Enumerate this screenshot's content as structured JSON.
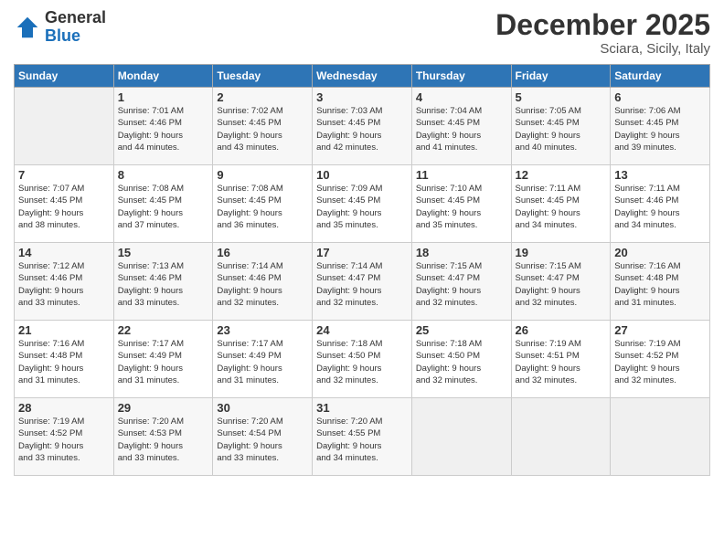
{
  "logo": {
    "general": "General",
    "blue": "Blue"
  },
  "title": "December 2025",
  "subtitle": "Sciara, Sicily, Italy",
  "headers": [
    "Sunday",
    "Monday",
    "Tuesday",
    "Wednesday",
    "Thursday",
    "Friday",
    "Saturday"
  ],
  "weeks": [
    [
      {
        "day": "",
        "detail": ""
      },
      {
        "day": "1",
        "detail": "Sunrise: 7:01 AM\nSunset: 4:46 PM\nDaylight: 9 hours\nand 44 minutes."
      },
      {
        "day": "2",
        "detail": "Sunrise: 7:02 AM\nSunset: 4:45 PM\nDaylight: 9 hours\nand 43 minutes."
      },
      {
        "day": "3",
        "detail": "Sunrise: 7:03 AM\nSunset: 4:45 PM\nDaylight: 9 hours\nand 42 minutes."
      },
      {
        "day": "4",
        "detail": "Sunrise: 7:04 AM\nSunset: 4:45 PM\nDaylight: 9 hours\nand 41 minutes."
      },
      {
        "day": "5",
        "detail": "Sunrise: 7:05 AM\nSunset: 4:45 PM\nDaylight: 9 hours\nand 40 minutes."
      },
      {
        "day": "6",
        "detail": "Sunrise: 7:06 AM\nSunset: 4:45 PM\nDaylight: 9 hours\nand 39 minutes."
      }
    ],
    [
      {
        "day": "7",
        "detail": "Sunrise: 7:07 AM\nSunset: 4:45 PM\nDaylight: 9 hours\nand 38 minutes."
      },
      {
        "day": "8",
        "detail": "Sunrise: 7:08 AM\nSunset: 4:45 PM\nDaylight: 9 hours\nand 37 minutes."
      },
      {
        "day": "9",
        "detail": "Sunrise: 7:08 AM\nSunset: 4:45 PM\nDaylight: 9 hours\nand 36 minutes."
      },
      {
        "day": "10",
        "detail": "Sunrise: 7:09 AM\nSunset: 4:45 PM\nDaylight: 9 hours\nand 35 minutes."
      },
      {
        "day": "11",
        "detail": "Sunrise: 7:10 AM\nSunset: 4:45 PM\nDaylight: 9 hours\nand 35 minutes."
      },
      {
        "day": "12",
        "detail": "Sunrise: 7:11 AM\nSunset: 4:45 PM\nDaylight: 9 hours\nand 34 minutes."
      },
      {
        "day": "13",
        "detail": "Sunrise: 7:11 AM\nSunset: 4:46 PM\nDaylight: 9 hours\nand 34 minutes."
      }
    ],
    [
      {
        "day": "14",
        "detail": "Sunrise: 7:12 AM\nSunset: 4:46 PM\nDaylight: 9 hours\nand 33 minutes."
      },
      {
        "day": "15",
        "detail": "Sunrise: 7:13 AM\nSunset: 4:46 PM\nDaylight: 9 hours\nand 33 minutes."
      },
      {
        "day": "16",
        "detail": "Sunrise: 7:14 AM\nSunset: 4:46 PM\nDaylight: 9 hours\nand 32 minutes."
      },
      {
        "day": "17",
        "detail": "Sunrise: 7:14 AM\nSunset: 4:47 PM\nDaylight: 9 hours\nand 32 minutes."
      },
      {
        "day": "18",
        "detail": "Sunrise: 7:15 AM\nSunset: 4:47 PM\nDaylight: 9 hours\nand 32 minutes."
      },
      {
        "day": "19",
        "detail": "Sunrise: 7:15 AM\nSunset: 4:47 PM\nDaylight: 9 hours\nand 32 minutes."
      },
      {
        "day": "20",
        "detail": "Sunrise: 7:16 AM\nSunset: 4:48 PM\nDaylight: 9 hours\nand 31 minutes."
      }
    ],
    [
      {
        "day": "21",
        "detail": "Sunrise: 7:16 AM\nSunset: 4:48 PM\nDaylight: 9 hours\nand 31 minutes."
      },
      {
        "day": "22",
        "detail": "Sunrise: 7:17 AM\nSunset: 4:49 PM\nDaylight: 9 hours\nand 31 minutes."
      },
      {
        "day": "23",
        "detail": "Sunrise: 7:17 AM\nSunset: 4:49 PM\nDaylight: 9 hours\nand 31 minutes."
      },
      {
        "day": "24",
        "detail": "Sunrise: 7:18 AM\nSunset: 4:50 PM\nDaylight: 9 hours\nand 32 minutes."
      },
      {
        "day": "25",
        "detail": "Sunrise: 7:18 AM\nSunset: 4:50 PM\nDaylight: 9 hours\nand 32 minutes."
      },
      {
        "day": "26",
        "detail": "Sunrise: 7:19 AM\nSunset: 4:51 PM\nDaylight: 9 hours\nand 32 minutes."
      },
      {
        "day": "27",
        "detail": "Sunrise: 7:19 AM\nSunset: 4:52 PM\nDaylight: 9 hours\nand 32 minutes."
      }
    ],
    [
      {
        "day": "28",
        "detail": "Sunrise: 7:19 AM\nSunset: 4:52 PM\nDaylight: 9 hours\nand 33 minutes."
      },
      {
        "day": "29",
        "detail": "Sunrise: 7:20 AM\nSunset: 4:53 PM\nDaylight: 9 hours\nand 33 minutes."
      },
      {
        "day": "30",
        "detail": "Sunrise: 7:20 AM\nSunset: 4:54 PM\nDaylight: 9 hours\nand 33 minutes."
      },
      {
        "day": "31",
        "detail": "Sunrise: 7:20 AM\nSunset: 4:55 PM\nDaylight: 9 hours\nand 34 minutes."
      },
      {
        "day": "",
        "detail": ""
      },
      {
        "day": "",
        "detail": ""
      },
      {
        "day": "",
        "detail": ""
      }
    ]
  ]
}
